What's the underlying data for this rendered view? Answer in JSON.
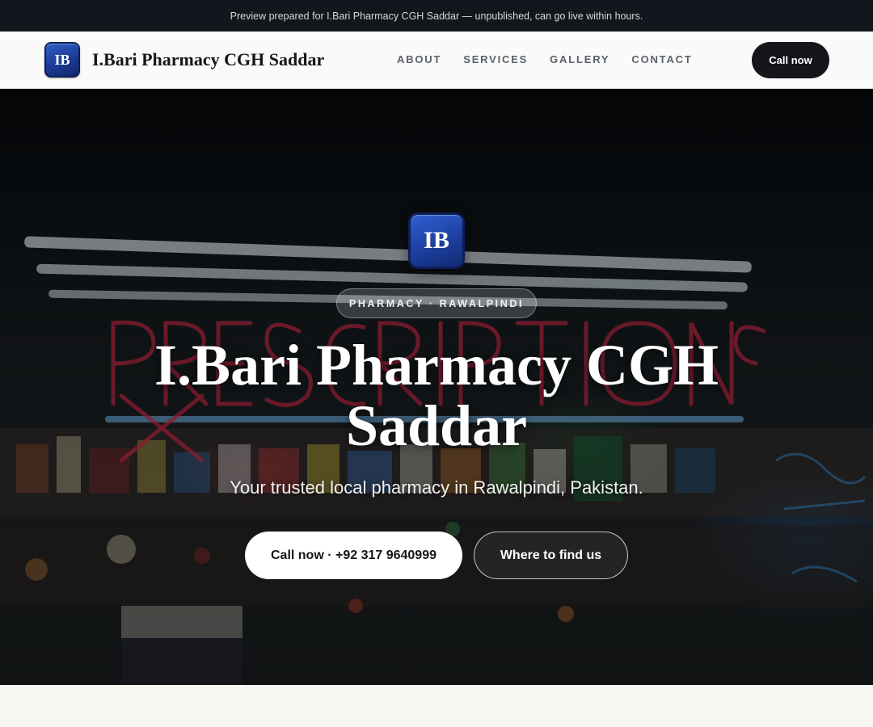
{
  "preview_banner": "Preview prepared for I.Bari Pharmacy CGH Saddar — unpublished, can go live within hours.",
  "header": {
    "logo_initials": "IB",
    "brand_name": "I.Bari Pharmacy CGH Saddar",
    "nav": [
      "ABOUT",
      "SERVICES",
      "GALLERY",
      "CONTACT"
    ],
    "cta_label": "Call now"
  },
  "hero": {
    "logo_initials": "IB",
    "tag": "PHARMACY · RAWALPINDI",
    "title": "I.Bari Pharmacy CGH Saddar",
    "subtitle": "Your trusted local pharmacy in Rawalpindi, Pakistan.",
    "primary_cta": "Call now · +92 317 9640999",
    "secondary_cta": "Where to find us",
    "background_image": "neon-prescriptions-pharmacy-storefront"
  },
  "colors": {
    "topbar_bg": "#13161c",
    "header_bg": "#fafaf8",
    "badge_blue": "#1d3fa0",
    "dark_button": "#14161b",
    "neon_red": "#d92745",
    "neon_blue": "#3aa8ff"
  }
}
